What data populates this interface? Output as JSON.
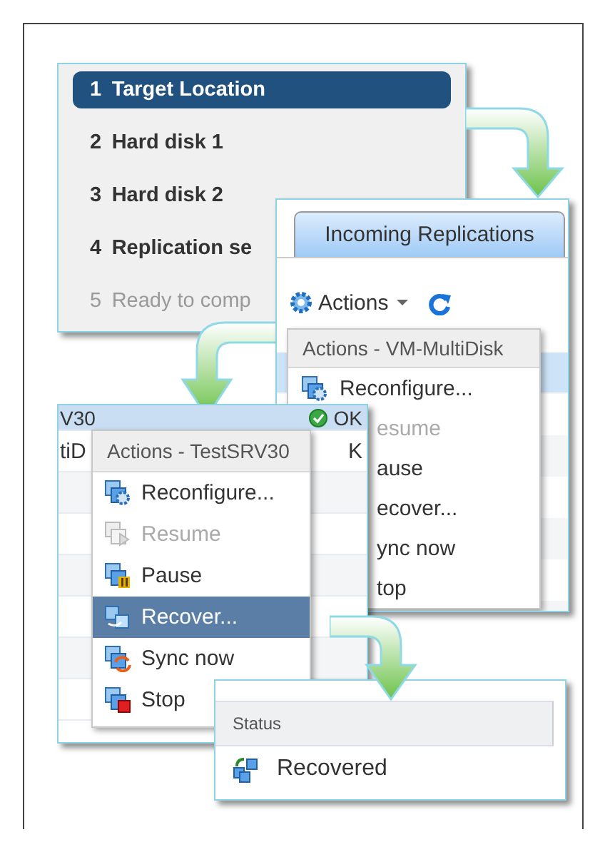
{
  "wizard_steps": [
    {
      "number": "1",
      "label": "Target Location",
      "selected": true,
      "disabled": false
    },
    {
      "number": "2",
      "label": "Hard disk 1",
      "selected": false,
      "disabled": false
    },
    {
      "number": "3",
      "label": "Hard disk 2",
      "selected": false,
      "disabled": false
    },
    {
      "number": "4",
      "label": "Replication se",
      "selected": false,
      "disabled": false
    },
    {
      "number": "5",
      "label": "Ready to comp",
      "selected": false,
      "disabled": true
    }
  ],
  "replications_panel": {
    "tab": {
      "label": "Incoming Replications",
      "selected": true
    },
    "actions_button": "Actions",
    "menu": {
      "title": "Actions - VM-MultiDisk",
      "items": [
        {
          "label": "Reconfigure...",
          "kind": "reconfigure",
          "disabled": false
        },
        {
          "label": "esume",
          "kind": "none",
          "disabled": true
        },
        {
          "label": "ause",
          "kind": "none",
          "disabled": false
        },
        {
          "label": "ecover...",
          "kind": "none",
          "disabled": false
        },
        {
          "label": "ync now",
          "kind": "none",
          "disabled": false
        },
        {
          "label": "top",
          "kind": "none",
          "disabled": false
        }
      ]
    }
  },
  "vm_table": {
    "rows": [
      {
        "name": "V30",
        "status": "OK",
        "selected": true,
        "kind": "ok"
      },
      {
        "name": "tiD",
        "status": "K",
        "selected": false,
        "kind": "none"
      }
    ]
  },
  "context_menu": {
    "title": "Actions - TestSRV30",
    "items": [
      {
        "label": "Reconfigure...",
        "kind": "reconfigure",
        "disabled": false,
        "selected": false
      },
      {
        "label": "Resume",
        "kind": "resume",
        "disabled": true,
        "selected": false
      },
      {
        "label": "Pause",
        "kind": "pause",
        "disabled": false,
        "selected": false
      },
      {
        "label": "Recover...",
        "kind": "recover",
        "disabled": false,
        "selected": true
      },
      {
        "label": "Sync now",
        "kind": "sync",
        "disabled": false,
        "selected": false
      },
      {
        "label": "Stop",
        "kind": "stop",
        "disabled": false,
        "selected": false
      }
    ]
  },
  "status_panel": {
    "column": "Status",
    "rows": [
      {
        "label": "Recovered"
      }
    ]
  }
}
